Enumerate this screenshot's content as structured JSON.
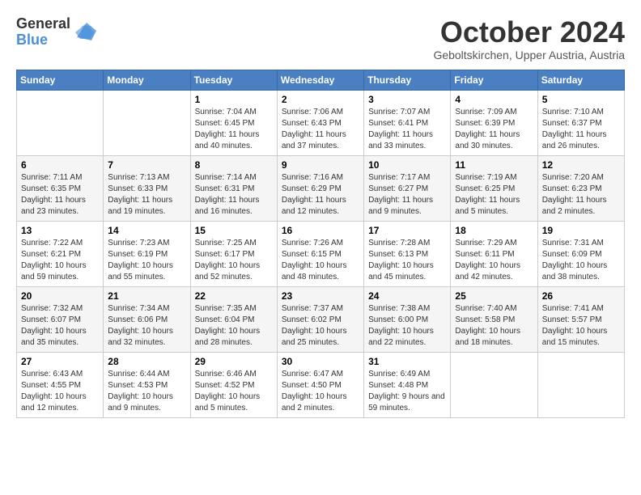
{
  "header": {
    "logo_general": "General",
    "logo_blue": "Blue",
    "month_title": "October 2024",
    "location": "Geboltskirchen, Upper Austria, Austria"
  },
  "weekdays": [
    "Sunday",
    "Monday",
    "Tuesday",
    "Wednesday",
    "Thursday",
    "Friday",
    "Saturday"
  ],
  "weeks": [
    [
      {
        "day": null,
        "info": null
      },
      {
        "day": null,
        "info": null
      },
      {
        "day": "1",
        "info": "Sunrise: 7:04 AM\nSunset: 6:45 PM\nDaylight: 11 hours and 40 minutes."
      },
      {
        "day": "2",
        "info": "Sunrise: 7:06 AM\nSunset: 6:43 PM\nDaylight: 11 hours and 37 minutes."
      },
      {
        "day": "3",
        "info": "Sunrise: 7:07 AM\nSunset: 6:41 PM\nDaylight: 11 hours and 33 minutes."
      },
      {
        "day": "4",
        "info": "Sunrise: 7:09 AM\nSunset: 6:39 PM\nDaylight: 11 hours and 30 minutes."
      },
      {
        "day": "5",
        "info": "Sunrise: 7:10 AM\nSunset: 6:37 PM\nDaylight: 11 hours and 26 minutes."
      }
    ],
    [
      {
        "day": "6",
        "info": "Sunrise: 7:11 AM\nSunset: 6:35 PM\nDaylight: 11 hours and 23 minutes."
      },
      {
        "day": "7",
        "info": "Sunrise: 7:13 AM\nSunset: 6:33 PM\nDaylight: 11 hours and 19 minutes."
      },
      {
        "day": "8",
        "info": "Sunrise: 7:14 AM\nSunset: 6:31 PM\nDaylight: 11 hours and 16 minutes."
      },
      {
        "day": "9",
        "info": "Sunrise: 7:16 AM\nSunset: 6:29 PM\nDaylight: 11 hours and 12 minutes."
      },
      {
        "day": "10",
        "info": "Sunrise: 7:17 AM\nSunset: 6:27 PM\nDaylight: 11 hours and 9 minutes."
      },
      {
        "day": "11",
        "info": "Sunrise: 7:19 AM\nSunset: 6:25 PM\nDaylight: 11 hours and 5 minutes."
      },
      {
        "day": "12",
        "info": "Sunrise: 7:20 AM\nSunset: 6:23 PM\nDaylight: 11 hours and 2 minutes."
      }
    ],
    [
      {
        "day": "13",
        "info": "Sunrise: 7:22 AM\nSunset: 6:21 PM\nDaylight: 10 hours and 59 minutes."
      },
      {
        "day": "14",
        "info": "Sunrise: 7:23 AM\nSunset: 6:19 PM\nDaylight: 10 hours and 55 minutes."
      },
      {
        "day": "15",
        "info": "Sunrise: 7:25 AM\nSunset: 6:17 PM\nDaylight: 10 hours and 52 minutes."
      },
      {
        "day": "16",
        "info": "Sunrise: 7:26 AM\nSunset: 6:15 PM\nDaylight: 10 hours and 48 minutes."
      },
      {
        "day": "17",
        "info": "Sunrise: 7:28 AM\nSunset: 6:13 PM\nDaylight: 10 hours and 45 minutes."
      },
      {
        "day": "18",
        "info": "Sunrise: 7:29 AM\nSunset: 6:11 PM\nDaylight: 10 hours and 42 minutes."
      },
      {
        "day": "19",
        "info": "Sunrise: 7:31 AM\nSunset: 6:09 PM\nDaylight: 10 hours and 38 minutes."
      }
    ],
    [
      {
        "day": "20",
        "info": "Sunrise: 7:32 AM\nSunset: 6:07 PM\nDaylight: 10 hours and 35 minutes."
      },
      {
        "day": "21",
        "info": "Sunrise: 7:34 AM\nSunset: 6:06 PM\nDaylight: 10 hours and 32 minutes."
      },
      {
        "day": "22",
        "info": "Sunrise: 7:35 AM\nSunset: 6:04 PM\nDaylight: 10 hours and 28 minutes."
      },
      {
        "day": "23",
        "info": "Sunrise: 7:37 AM\nSunset: 6:02 PM\nDaylight: 10 hours and 25 minutes."
      },
      {
        "day": "24",
        "info": "Sunrise: 7:38 AM\nSunset: 6:00 PM\nDaylight: 10 hours and 22 minutes."
      },
      {
        "day": "25",
        "info": "Sunrise: 7:40 AM\nSunset: 5:58 PM\nDaylight: 10 hours and 18 minutes."
      },
      {
        "day": "26",
        "info": "Sunrise: 7:41 AM\nSunset: 5:57 PM\nDaylight: 10 hours and 15 minutes."
      }
    ],
    [
      {
        "day": "27",
        "info": "Sunrise: 6:43 AM\nSunset: 4:55 PM\nDaylight: 10 hours and 12 minutes."
      },
      {
        "day": "28",
        "info": "Sunrise: 6:44 AM\nSunset: 4:53 PM\nDaylight: 10 hours and 9 minutes."
      },
      {
        "day": "29",
        "info": "Sunrise: 6:46 AM\nSunset: 4:52 PM\nDaylight: 10 hours and 5 minutes."
      },
      {
        "day": "30",
        "info": "Sunrise: 6:47 AM\nSunset: 4:50 PM\nDaylight: 10 hours and 2 minutes."
      },
      {
        "day": "31",
        "info": "Sunrise: 6:49 AM\nSunset: 4:48 PM\nDaylight: 9 hours and 59 minutes."
      },
      {
        "day": null,
        "info": null
      },
      {
        "day": null,
        "info": null
      }
    ]
  ]
}
